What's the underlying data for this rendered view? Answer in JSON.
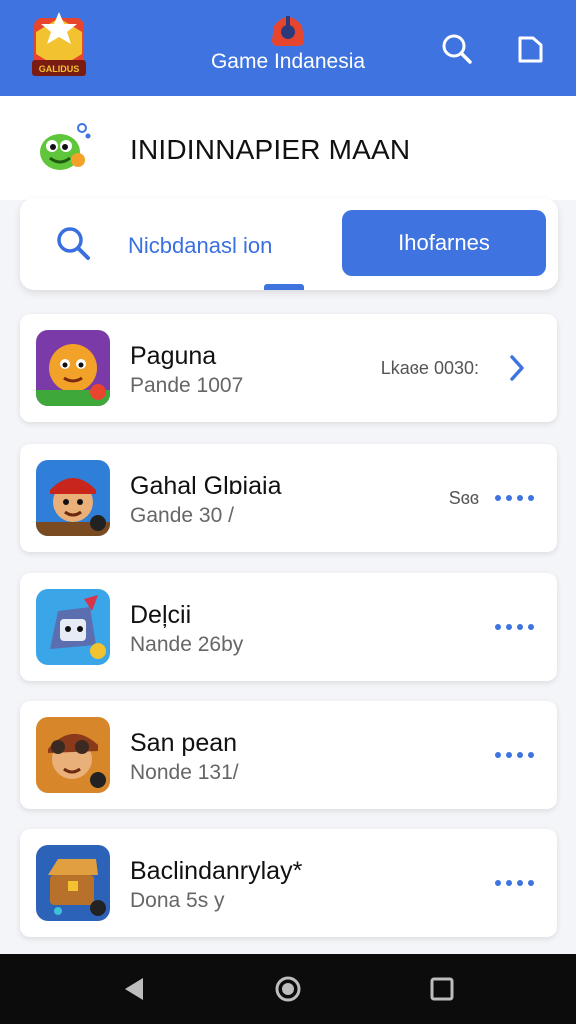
{
  "header": {
    "title": "Game Indanesia",
    "logo_badge": "GALIDUS"
  },
  "page": {
    "title": "INIDINNAPIER MAAN"
  },
  "tabs": {
    "left_label": "Nicbdanasl ion",
    "right_label": "Ihofarnes"
  },
  "games": [
    {
      "name": "Paguna",
      "sub": "Pande 1007",
      "meta": "Lkaɞe 0030:",
      "action": "chevron-right-icon"
    },
    {
      "name": "Gahal  Glɒiaia",
      "sub": "Gande  30 /",
      "meta": "Sɞɞ",
      "action": "more-dots-icon"
    },
    {
      "name": "Deļcii",
      "sub": "Nande  26by",
      "meta": "",
      "action": "more-dots-icon"
    },
    {
      "name": "San pean",
      "sub": "Nonde 131/",
      "meta": "",
      "action": "more-dots-icon"
    },
    {
      "name": "Baclindanrylay*",
      "sub": "Dona    5s y",
      "meta": "",
      "action": "more-dots-icon"
    }
  ],
  "colors": {
    "primary": "#3f74e0",
    "background": "#f4f5f8",
    "card": "#ffffff",
    "navbar": "#0c0c0c"
  }
}
